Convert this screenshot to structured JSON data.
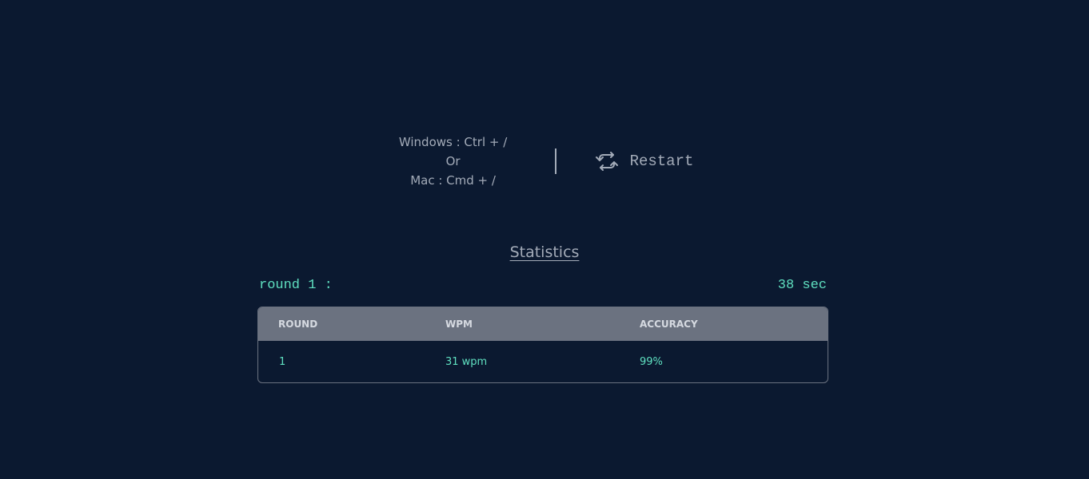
{
  "shortcut": {
    "windows": "Windows : Ctrl + /",
    "or": "Or",
    "mac": "Mac : Cmd + /"
  },
  "restart": {
    "label": "Restart",
    "icon": "refresh-icon"
  },
  "statistics": {
    "title": "Statistics",
    "round_label": "round 1 :",
    "time": "38 sec",
    "columns": [
      "ROUND",
      "WPM",
      "ACCURACY"
    ],
    "rows": [
      {
        "round": "1",
        "wpm": "31 wpm",
        "accuracy": "99%"
      }
    ]
  },
  "colors": {
    "background": "#0b1930",
    "text_muted": "#a3abb8",
    "accent": "#5fe0c0",
    "table_header": "#6b7280"
  }
}
